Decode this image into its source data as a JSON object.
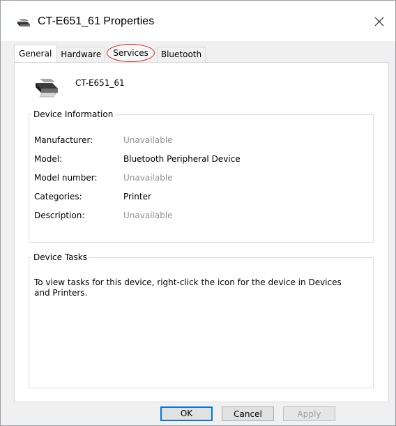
{
  "window": {
    "title": "CT-E651_61 Properties",
    "icon": "printer-icon",
    "close_icon": "close-icon"
  },
  "tabs": [
    {
      "label": "General",
      "active": true
    },
    {
      "label": "Hardware",
      "active": false
    },
    {
      "label": "Services",
      "active": false,
      "annotated": true
    },
    {
      "label": "Bluetooth",
      "active": false
    }
  ],
  "device": {
    "name": "CT-E651_61",
    "icon": "printer-icon"
  },
  "device_information": {
    "title": "Device Information",
    "rows": [
      {
        "label": "Manufacturer:",
        "value": "Unavailable",
        "muted": true
      },
      {
        "label": "Model:",
        "value": "Bluetooth Peripheral Device",
        "muted": false
      },
      {
        "label": "Model number:",
        "value": "Unavailable",
        "muted": true
      },
      {
        "label": "Categories:",
        "value": "Printer",
        "muted": false
      },
      {
        "label": "Description:",
        "value": "Unavailable",
        "muted": true
      }
    ]
  },
  "device_tasks": {
    "title": "Device Tasks",
    "text": "To view tasks for this device, right-click the icon for the device in Devices and Printers."
  },
  "buttons": {
    "ok": "OK",
    "cancel": "Cancel",
    "apply": "Apply"
  },
  "colors": {
    "annotation": "#d81e1e",
    "focus": "#0078d7",
    "muted_text": "#909090"
  }
}
